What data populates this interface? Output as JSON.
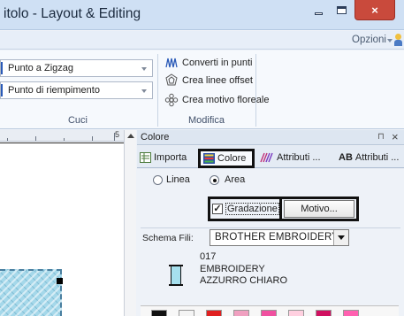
{
  "window": {
    "title": "itolo - Layout & Editing",
    "close_glyph": "×"
  },
  "menubar": {
    "options_label": "Opzioni"
  },
  "ribbon": {
    "stitch_group": {
      "zigzag_label": "Punto a Zigzag",
      "fill_label": "Punto di riempimento",
      "group_label": "Cuci"
    },
    "modify_group": {
      "convert_label": "Converti in punti",
      "offset_label": "Crea linee offset",
      "floral_label": "Crea motivo floreale",
      "group_label": "Modifica"
    }
  },
  "canvas": {
    "ruler_number": "5"
  },
  "panel": {
    "title": "Colore",
    "pin_glyph": "⊓",
    "close_glyph": "×",
    "tabs": [
      {
        "label": "Importa"
      },
      {
        "label": "Colore"
      },
      {
        "label": "Attributi ..."
      },
      {
        "label": "Attributi ..."
      }
    ],
    "attr_prefix": "AB",
    "mode": {
      "line_label": "Linea",
      "area_label": "Area",
      "selected": "Area"
    },
    "gradient": {
      "label": "Gradazione",
      "checked": true,
      "check_glyph": "✓"
    },
    "motif_button": "Motivo...",
    "thread_chart": {
      "label": "Schema Fili:",
      "value": "BROTHER EMBROIDERY"
    },
    "thread": {
      "code": "017",
      "brand": "EMBROIDERY",
      "name": "AZZURRO CHIARO",
      "color": "#a6e0ee"
    },
    "swatch_colors": [
      "#111111",
      "#f4f4f4",
      "#e02020",
      "#f0a0c0",
      "#f050a0",
      "#ffd0e0",
      "#d01060",
      "#ff60b0"
    ]
  },
  "colors": {
    "accent": "#2a5ab8",
    "close_red": "#c94a3c",
    "highlight_border": "#111111"
  }
}
